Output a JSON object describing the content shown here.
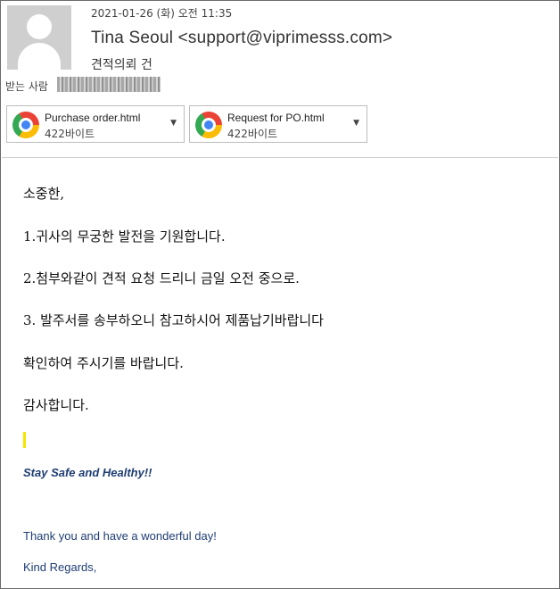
{
  "header": {
    "date": "2021-01-26 (화) 오전 11:35",
    "sender": "Tina Seoul <support@viprimesss.com>",
    "subject": "견적의뢰 건",
    "to_label": "받는 사람"
  },
  "attachments": [
    {
      "name": "Purchase order.html",
      "size": "422바이트",
      "icon": "chrome-icon"
    },
    {
      "name": "Request for PO.html",
      "size": "422바이트",
      "icon": "chrome-icon"
    }
  ],
  "body": {
    "lines": [
      "소중한,",
      "1.귀사의 무궁한 발전을 기원합니다.",
      "2.첨부와같이 견적 요청 드리니 금일 오전 중으로.",
      "3. 발주서를 송부하오니 참고하시어 제품납기바랍니다",
      "확인하여 주시기를 바랍니다.",
      "감사합니다."
    ]
  },
  "signature": {
    "tagline": "Stay Safe and Healthy!!",
    "thanks": "Thank you and have a wonderful day!",
    "closing": "Kind Regards,"
  },
  "colors": {
    "signature": "#1f3d73",
    "cursor_highlight": "#f5e400"
  }
}
